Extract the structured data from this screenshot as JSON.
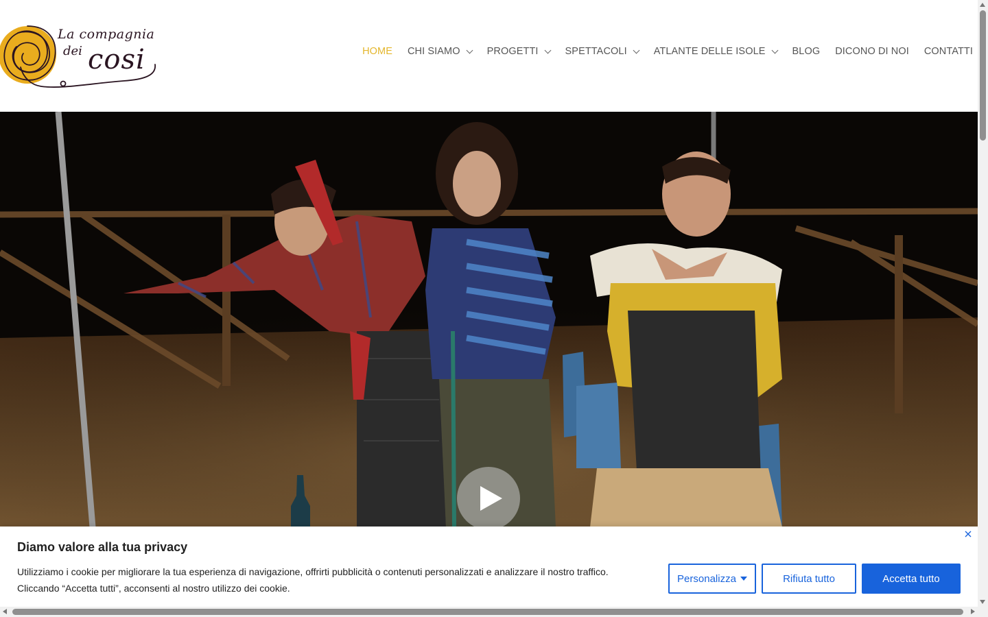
{
  "brand": {
    "logo_line1": "La compagnia",
    "logo_line2a": "dei",
    "logo_line2b": "cosi",
    "logo_primary_color": "#2a1421",
    "logo_accent_color": "#e9ac1e"
  },
  "nav": {
    "items": [
      {
        "label": "HOME",
        "active": true,
        "has_dropdown": false
      },
      {
        "label": "CHI SIAMO",
        "active": false,
        "has_dropdown": true
      },
      {
        "label": "PROGETTI",
        "active": false,
        "has_dropdown": true
      },
      {
        "label": "SPETTACOLI",
        "active": false,
        "has_dropdown": true
      },
      {
        "label": "ATLANTE DELLE ISOLE",
        "active": false,
        "has_dropdown": true
      },
      {
        "label": "BLOG",
        "active": false,
        "has_dropdown": false
      },
      {
        "label": "DICONO DI NOI",
        "active": false,
        "has_dropdown": false
      },
      {
        "label": "CONTATTI",
        "active": false,
        "has_dropdown": false
      }
    ],
    "active_color": "#e4b62c"
  },
  "hero": {
    "play_icon": "play-icon"
  },
  "cookie": {
    "title": "Diamo valore alla tua privacy",
    "text_line1": "Utilizziamo i cookie per migliorare la tua esperienza di navigazione, offrirti pubblicità o contenuti personalizzati e analizzare il nostro traffico.",
    "text_line2": "Cliccando “Accetta tutti”, acconsenti al nostro utilizzo dei cookie.",
    "customize_label": "Personalizza",
    "reject_label": "Rifiuta tutto",
    "accept_label": "Accetta tutto",
    "accent_color": "#1863dc"
  }
}
